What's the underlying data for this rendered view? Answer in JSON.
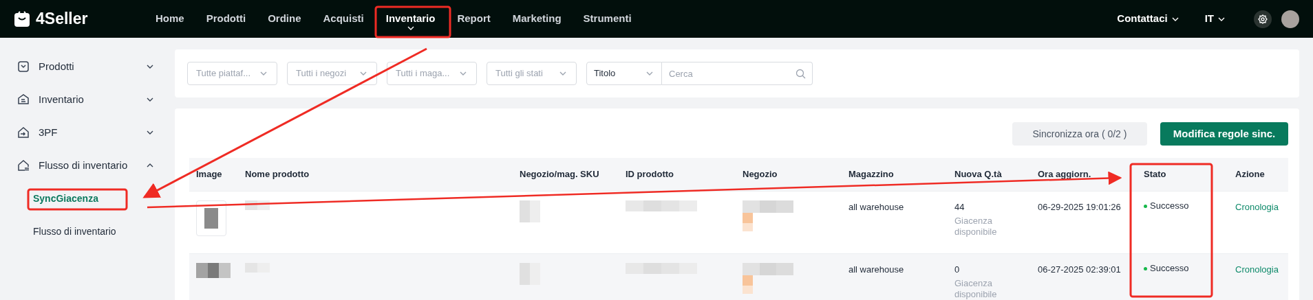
{
  "top_bar": {
    "logo": "4Seller",
    "nav": [
      {
        "label": "Home",
        "selected": false
      },
      {
        "label": "Prodotti",
        "selected": false
      },
      {
        "label": "Ordine",
        "selected": false
      },
      {
        "label": "Acquisti",
        "selected": false
      },
      {
        "label": "Inventario",
        "selected": true
      },
      {
        "label": "Report",
        "selected": false
      },
      {
        "label": "Marketing",
        "selected": false
      },
      {
        "label": "Strumenti",
        "selected": false
      }
    ],
    "contact": "Contattaci",
    "language": "IT"
  },
  "sidebar": {
    "items": [
      {
        "label": "Prodotti",
        "expanded": false
      },
      {
        "label": "Inventario",
        "expanded": false
      },
      {
        "label": "3PF",
        "expanded": false
      },
      {
        "label": "Flusso di inventario",
        "expanded": true,
        "children": [
          {
            "label": "SyncGiacenza",
            "selected": true
          },
          {
            "label": "Flusso di inventario",
            "selected": false
          }
        ]
      }
    ]
  },
  "filters": {
    "selects": [
      "Tutte piattaf...",
      "Tutti i negozi",
      "Tutti i maga...",
      "Tutti gli stati"
    ],
    "search_type": "Titolo",
    "search": {
      "placeholder": "Cerca"
    }
  },
  "actions": {
    "sync": "Sincronizza ora ( 0/2 )",
    "edit_rules": "Modifica regole sinc."
  },
  "table": {
    "columns": [
      "Image",
      "Nome prodotto",
      "Negozio/mag. SKU",
      "ID prodotto",
      "Negozio",
      "Magazzino",
      "Nuova Q.tà",
      "Ora aggiorn.",
      "Stato",
      "Azione"
    ],
    "rows": [
      {
        "warehouse": "all warehouse",
        "quantity": "44",
        "quantity_note": "Giacenza disponibile",
        "updated": "06-29-2025 19:01:26",
        "status": "Successo",
        "color": "#16b84a",
        "action": "Cronologia"
      },
      {
        "warehouse": "all warehouse",
        "quantity": "0",
        "quantity_note": "Giacenza disponibile",
        "updated": "06-27-2025 02:39:01",
        "status": "Successo",
        "color": "#16b84a",
        "action": "Cronologia"
      }
    ]
  }
}
